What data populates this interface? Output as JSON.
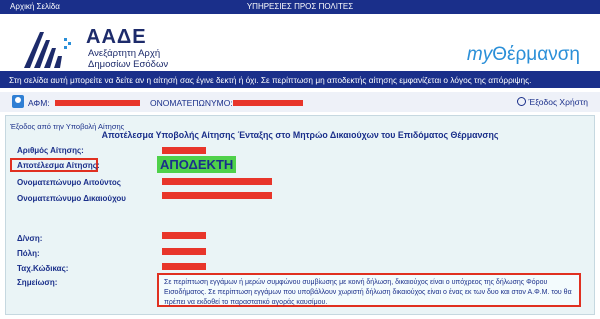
{
  "topbar": {
    "home_link": "Αρχική Σελίδα",
    "services": "ΥΠΗΡΕΣΙΕΣ ΠΡΟΣ ΠΟΛΙΤΕΣ"
  },
  "header": {
    "org_name": "ΑΑΔΕ",
    "org_sub_line1": "Ανεξάρτητη Αρχή",
    "org_sub_line2": "Δημοσίων Εσόδων",
    "brand_my": "my",
    "brand_name": "Θέρμανση"
  },
  "info_strip": "Στη σελίδα αυτή μπορείτε να δείτε αν η αίτησή σας έγινε δεκτή ή όχι. Σε περίπτωση μη αποδεκτής αίτησης εμφανίζεται ο λόγος της απόρριψης.",
  "userbar": {
    "afm_label": "ΑΦΜ:",
    "name_label": "ΟΝΟΜΑΤΕΠΩΝΥΜΟ:",
    "exit_label": "Έξοδος Χρήστη"
  },
  "main": {
    "back_link": "Έξοδος από την Υποβολή Αίτησης",
    "title": "Αποτέλεσμα Υποβολής Αίτησης Ένταξης στο Μητρώο Δικαιούχων του Επιδόματος Θέρμανσης",
    "fields": {
      "application_number": "Αριθμός Αίτησης:",
      "application_result": "Αποτέλεσμα Αίτησης:",
      "applicant_name": "Ονοματεπώνυμο Αιτούντος",
      "beneficiary_name": "Ονοματεπώνυμο Δικαιούχου",
      "address": "Δ/νση:",
      "city": "Πόλη:",
      "postal_code": "Ταχ.Κώδικας:",
      "note": "Σημείωση:"
    },
    "result_value": "ΑΠΟΔΕΚΤΗ",
    "note_text": "Σε περίπτωση εγγάμων ή μερών συμφώνου συμβίωσης με κοινή δήλωση, δικαιούχος είναι ο υπόχρεος της δήλωσης Φόρου Εισοδήματος. Σε περίπτωση εγγάμων που υποβάλλουν χωριστή δήλωση δικαιούχος είναι ο ένας εκ των δυο και στον Α.Φ.Μ. του θα πρέπει να εκδοθεί το παραστατικό αγοράς καυσίμου."
  },
  "colors": {
    "navy": "#1a2f8a",
    "redaction": "#e8352a",
    "accepted_highlight": "#4fd14a",
    "brand_blue": "#2a8fd8"
  }
}
